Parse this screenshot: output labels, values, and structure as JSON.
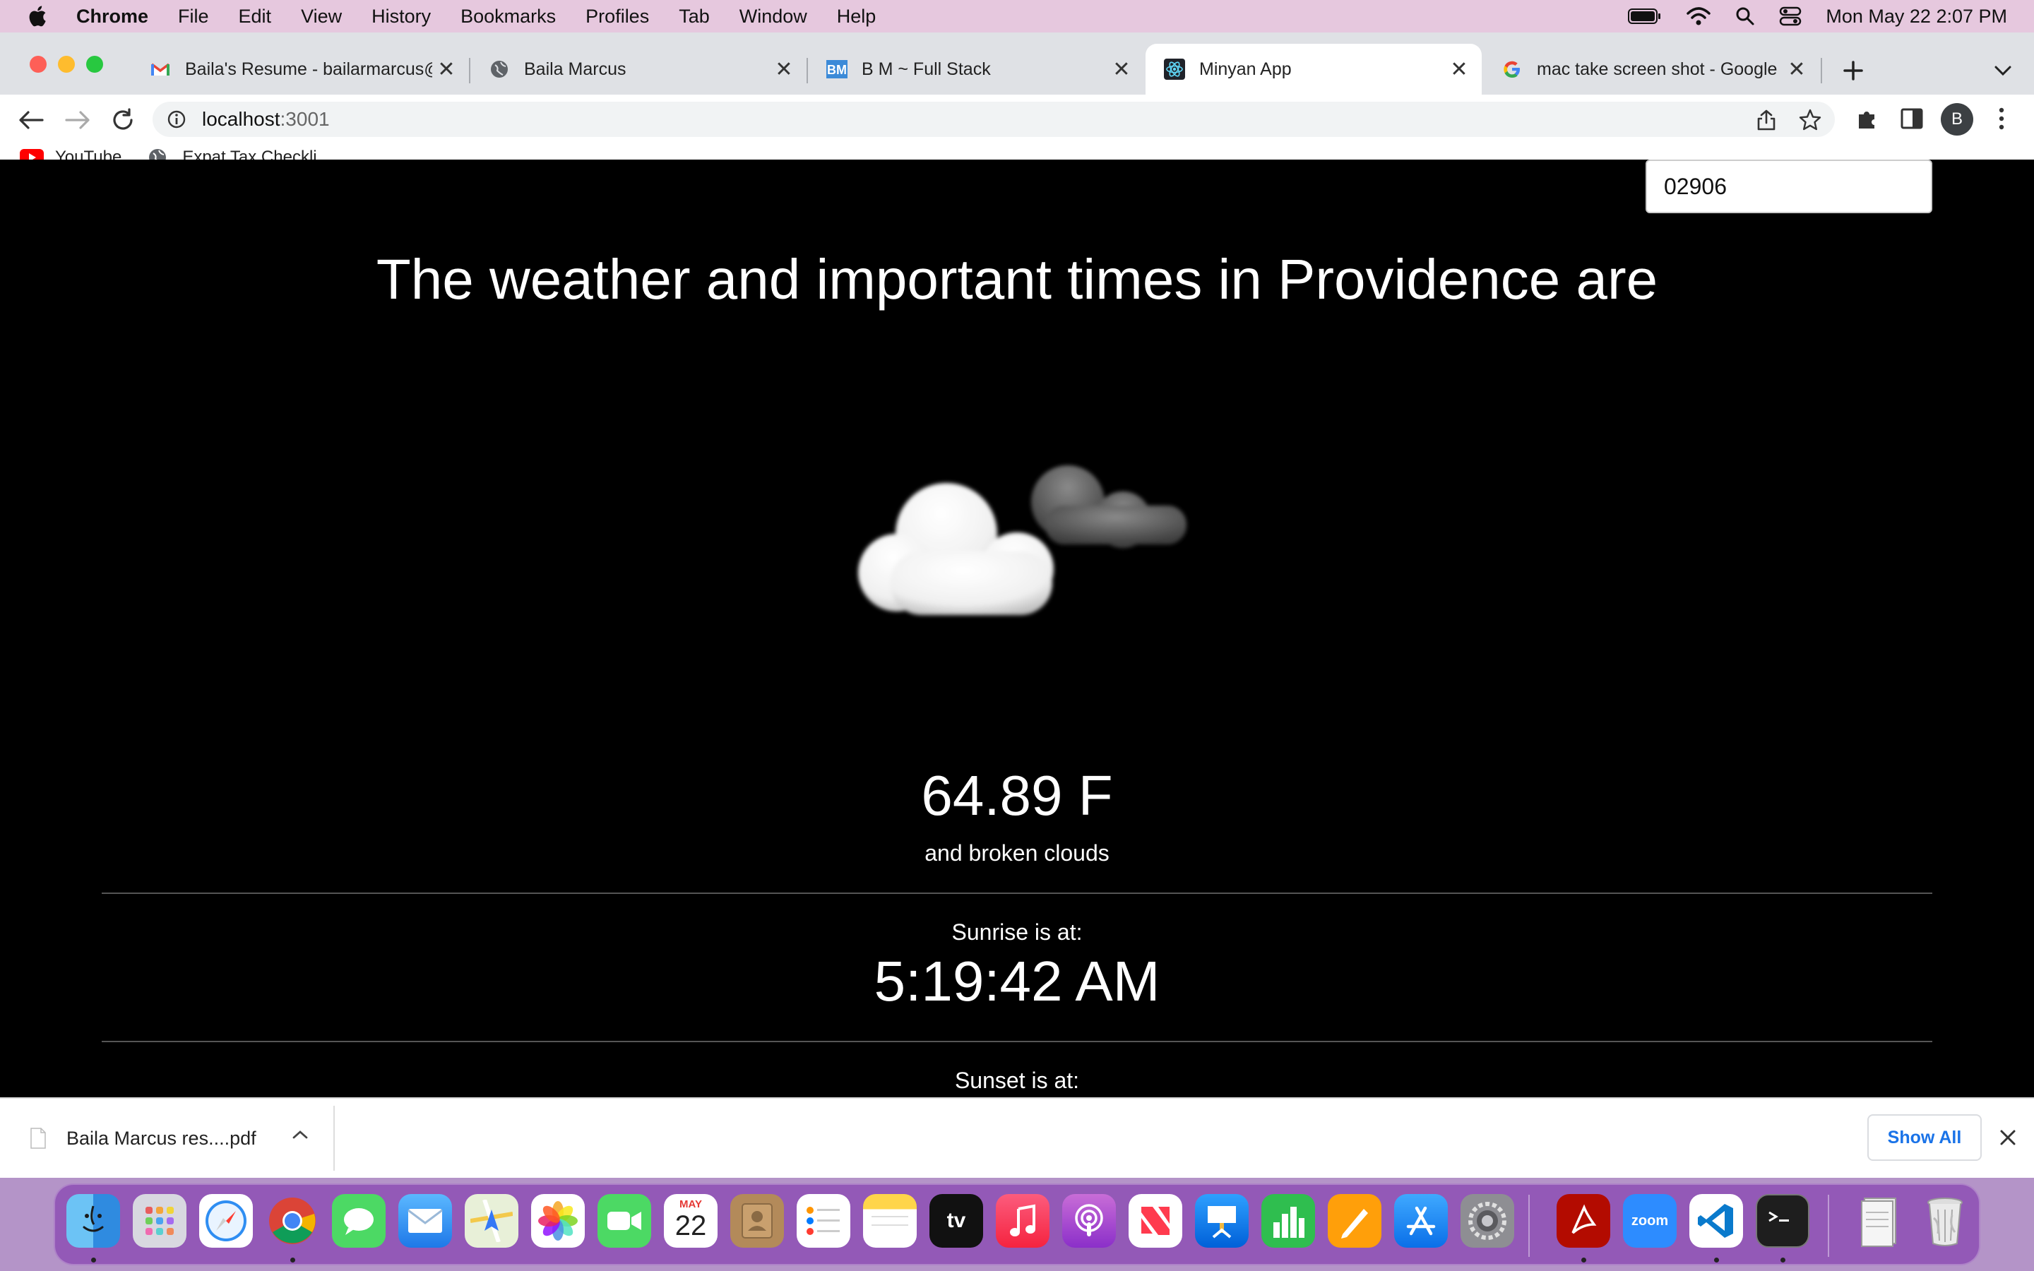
{
  "menubar": {
    "app_name": "Chrome",
    "items": [
      "File",
      "Edit",
      "View",
      "History",
      "Bookmarks",
      "Profiles",
      "Tab",
      "Window",
      "Help"
    ],
    "clock": "Mon May 22  2:07 PM"
  },
  "tabs": [
    {
      "title": "Baila's Resume - bailarmarcus@",
      "favicon": "gmail-icon"
    },
    {
      "title": "Baila Marcus",
      "favicon": "globe-icon"
    },
    {
      "title": "B M ~ Full Stack",
      "favicon": "bm-logo-icon"
    },
    {
      "title": "Minyan App",
      "favicon": "react-icon"
    },
    {
      "title": "mac take screen shot - Google",
      "favicon": "google-icon"
    }
  ],
  "toolbar": {
    "url_host": "localhost",
    "url_port": ":3001",
    "profile_initial": "B"
  },
  "bookmarks": [
    {
      "label": "YouTube",
      "icon": "youtube-icon"
    },
    {
      "label": "Expat Tax Checkli...",
      "icon": "globe-icon"
    }
  ],
  "page": {
    "zip_value": "02906",
    "headline": "The weather and important times in Providence are",
    "temperature": "64.89 F",
    "description": "and broken clouds",
    "sunrise_label": "Sunrise is at:",
    "sunrise_time": "5:19:42 AM",
    "sunset_label": "Sunset is at:",
    "weather_icon": "broken-clouds-icon"
  },
  "download": {
    "filename": "Baila Marcus res....pdf",
    "show_all": "Show All"
  },
  "dock": {
    "calendar_month": "MAY",
    "calendar_day": "22",
    "tv_label": "tv",
    "zoom_label": "zoom",
    "apps": [
      "finder",
      "launchpad",
      "safari",
      "chrome",
      "messages",
      "mail",
      "maps",
      "photos",
      "facetime",
      "calendar",
      "contacts",
      "reminders",
      "notes",
      "tv",
      "music",
      "podcasts",
      "news",
      "keynote",
      "numbers",
      "pages",
      "app-store",
      "system-preferences",
      "acrobat",
      "zoom",
      "vscode",
      "terminal",
      "downloads",
      "trash"
    ]
  },
  "colors": {
    "menubar_bg": "#e6c8de",
    "tabstrip_bg": "#dfe1e5",
    "page_bg": "#000000",
    "link_blue": "#1a73e8"
  }
}
